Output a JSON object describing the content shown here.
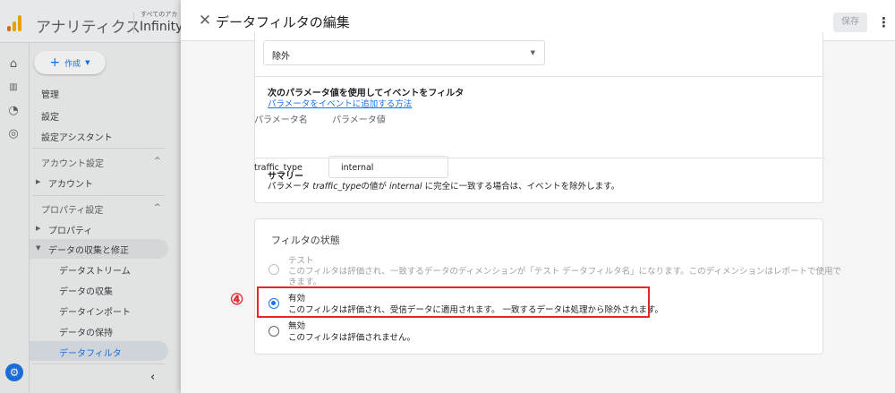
{
  "app": {
    "title": "アナリティクス",
    "account_label": "すべてのアカ",
    "property_name": "Infinity"
  },
  "sidebar": {
    "create_label": "作成",
    "items": [
      {
        "label": "管理"
      },
      {
        "label": "設定"
      },
      {
        "label": "設定アシスタント"
      }
    ],
    "account_section": {
      "label": "アカウント設定",
      "items": [
        {
          "label": "アカウント"
        }
      ]
    },
    "property_section": {
      "label": "プロパティ設定",
      "items": [
        {
          "label": "プロパティ"
        },
        {
          "label": "データの収集と修正"
        }
      ],
      "sub_items": [
        {
          "label": "データストリーム"
        },
        {
          "label": "データの収集"
        },
        {
          "label": "データインポート"
        },
        {
          "label": "データの保持"
        },
        {
          "label": "データフィルタ"
        }
      ]
    }
  },
  "panel": {
    "title": "データフィルタの編集",
    "save_label": "保存",
    "operation_value": "除外",
    "params": {
      "heading": "次のパラメータ値を使用してイベントをフィルタ",
      "link": "パラメータをイベントに追加する方法",
      "col_name": "パラメータ名",
      "col_value": "パラメータ値",
      "name": "traffic_type",
      "value": "internal"
    },
    "summary": {
      "heading": "サマリー",
      "prefix": "パラメータ",
      "param": "traffic_type",
      "mid": "の値が",
      "value": "internal",
      "suffix": "に完全に一致する場合は、イベントを除外します。"
    },
    "filter_state": {
      "title": "フィルタの状態",
      "options": [
        {
          "label": "テスト",
          "desc_line1": "このフィルタは評価され、一致するデータのディメンションが「テスト データフィルタ名」になります。このディメンションはレポートで使用で",
          "desc_line2": "きます。"
        },
        {
          "label": "有効",
          "desc_line1": "このフィルタは評価され、受信データに適用されます。 一致するデータは処理から除外されます。"
        },
        {
          "label": "無効",
          "desc_line1": "このフィルタは評価されません。"
        }
      ],
      "selected": "有効"
    }
  },
  "annotation": {
    "step": "④",
    "color": "#e8232d"
  },
  "colors": {
    "accent": "#1a73e8",
    "logo_orange": "#f9ab00",
    "logo_dark": "#e37400"
  }
}
